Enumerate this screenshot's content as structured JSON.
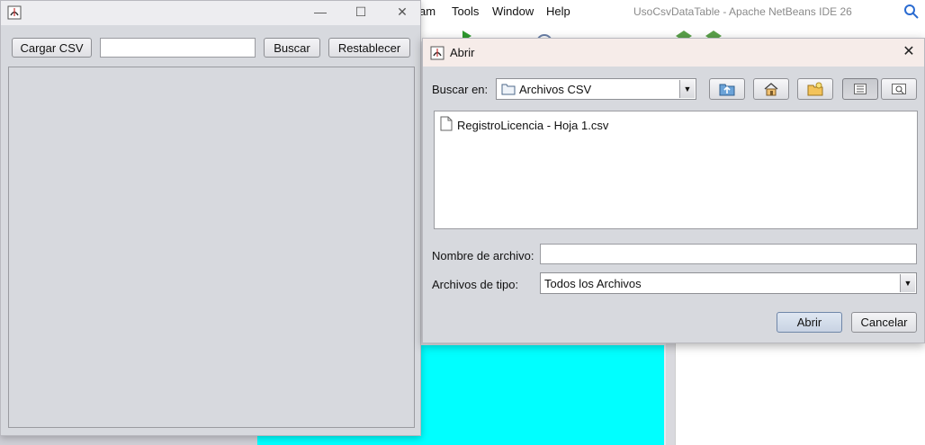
{
  "ide": {
    "menu": [
      "am",
      "Tools",
      "Window",
      "Help"
    ],
    "title": "UsoCsvDataTable - Apache NetBeans IDE 26"
  },
  "main_window": {
    "controls": {
      "minimize": "—",
      "maximize": "☐",
      "close": "✕"
    },
    "load_button": "Cargar CSV",
    "search_value": "",
    "search_button": "Buscar",
    "reset_button": "Restablecer"
  },
  "dialog": {
    "title": "Abrir",
    "close": "✕",
    "look_in_label": "Buscar en:",
    "look_in_value": "Archivos CSV",
    "files": [
      {
        "name": "RegistroLicencia - Hoja 1.csv",
        "icon": "file-icon"
      }
    ],
    "filename_label": "Nombre de archivo:",
    "filename_value": "",
    "filetype_label": "Archivos de tipo:",
    "filetype_value": "Todos los Archivos",
    "open_button": "Abrir",
    "cancel_button": "Cancelar",
    "toolbar_icons": [
      "up-folder-icon",
      "home-icon",
      "new-folder-icon",
      "list-view-icon",
      "details-view-icon"
    ]
  },
  "colors": {
    "window_bg": "#d7d9de",
    "dialog_titlebar": "#f6ece9",
    "cyan_panel": "#00ffff"
  }
}
